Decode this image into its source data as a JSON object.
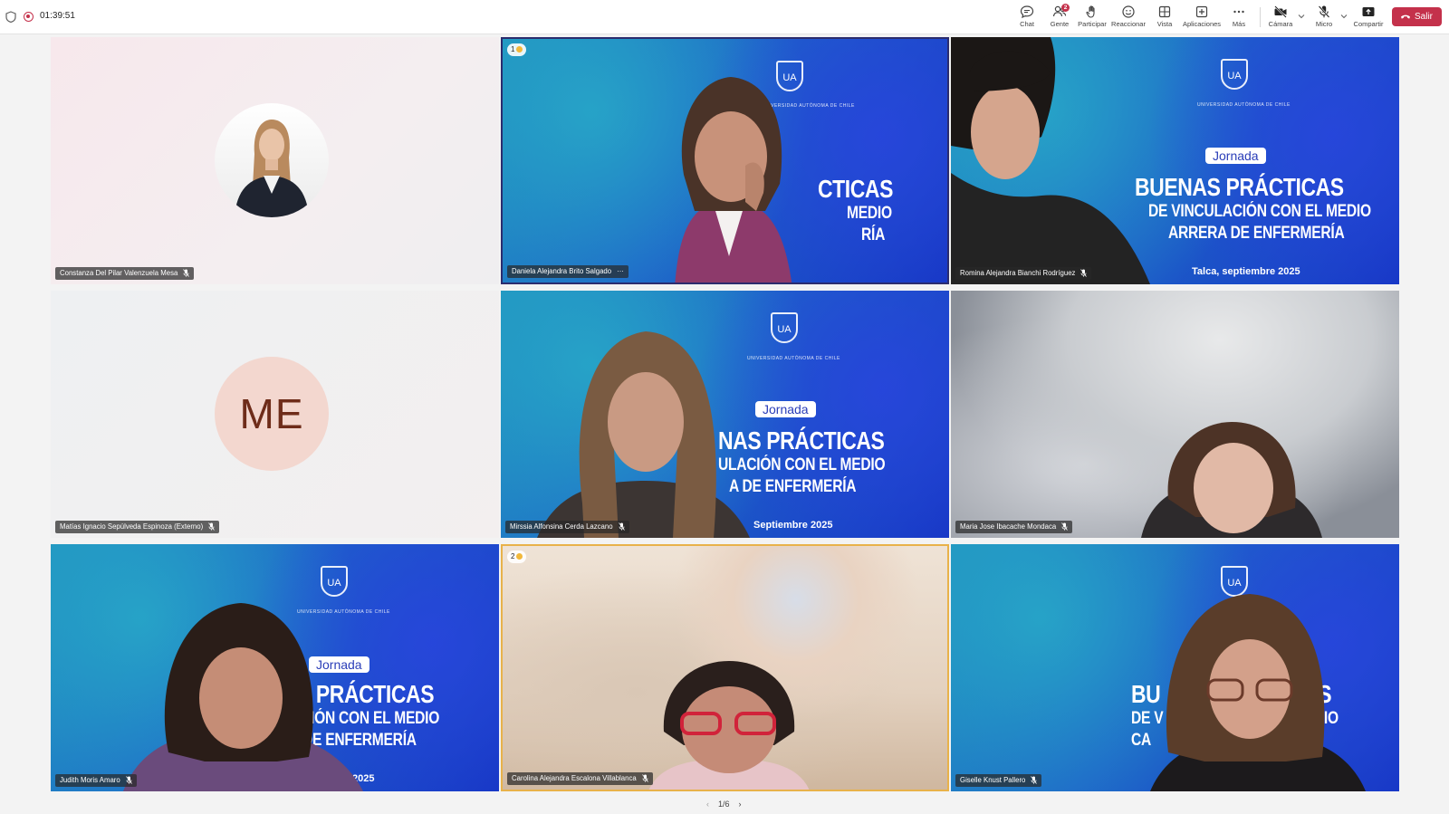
{
  "topbar": {
    "timer": "01:39:51",
    "tools": {
      "chat": "Chat",
      "people": "Gente",
      "people_badge": "2",
      "raise": "Participar",
      "react": "Reaccionar",
      "view": "Vista",
      "apps": "Aplicaciones",
      "more": "Más",
      "camera": "Cámara",
      "mic": "Micro",
      "share": "Compartir",
      "leave": "Salir"
    }
  },
  "banner": {
    "jornada": "Jornada",
    "title1": "BUENAS PRÁCTICAS",
    "title2": "DE VINCULACIÓN CON EL MEDIO",
    "title3": "CARRERA DE ENFERMERÍA",
    "place_date": "Talca, septiembre 2025",
    "university": "UNIVERSIDAD AUTÓNOMA DE CHILE",
    "logo": "UA",
    "t2_title1": "CTICAS",
    "t2_title2": "MEDIO",
    "t2_title3": "RÍA",
    "t3_title2": "DE VINCULACIÓN CON EL MEDIO",
    "t3_title3": "ARRERA DE ENFERMERÍA",
    "t5_title1": "NAS PRÁCTICAS",
    "t5_title2": "ULACIÓN CON EL MEDIO",
    "t5_title3": "A DE ENFERMERÍA",
    "t5_date": "Septiembre 2025",
    "t7_title1": "S PRÁCTICAS",
    "t7_title2": "CIÓN CON EL MEDIO",
    "t7_title3": "DE ENFERMERÍA",
    "t7_date": "2025",
    "t9_title1a": "BU",
    "t9_title1b": "ICAS",
    "t9_title2a": "DE V",
    "t9_title2b": "MEDIO",
    "t9_title3": "CA"
  },
  "participants": [
    {
      "name": "Constanza Del Pilar Valenzuela Mesa"
    },
    {
      "name": "Daniela Alejandra Brito Salgado",
      "hand": "1",
      "more": "···"
    },
    {
      "name": "Romina Alejandra Bianchi Rodríguez"
    },
    {
      "name": "Matías Ignacio Sepúlveda Espinoza (Externo)",
      "initials": "ME"
    },
    {
      "name": "Mirssia Alfonsina Cerda Lazcano"
    },
    {
      "name": "Maria Jose Ibacache Mondaca"
    },
    {
      "name": "Judith Moris Amaro"
    },
    {
      "name": "Carolina Alejandra Escalona Villablanca",
      "hand": "2"
    },
    {
      "name": "Giselle Knust Pallero"
    }
  ],
  "pager": "1/6",
  "colors": {
    "leave": "#c4314b",
    "accent_active": "#2b2c6e",
    "hand_active": "#e8b24a"
  }
}
